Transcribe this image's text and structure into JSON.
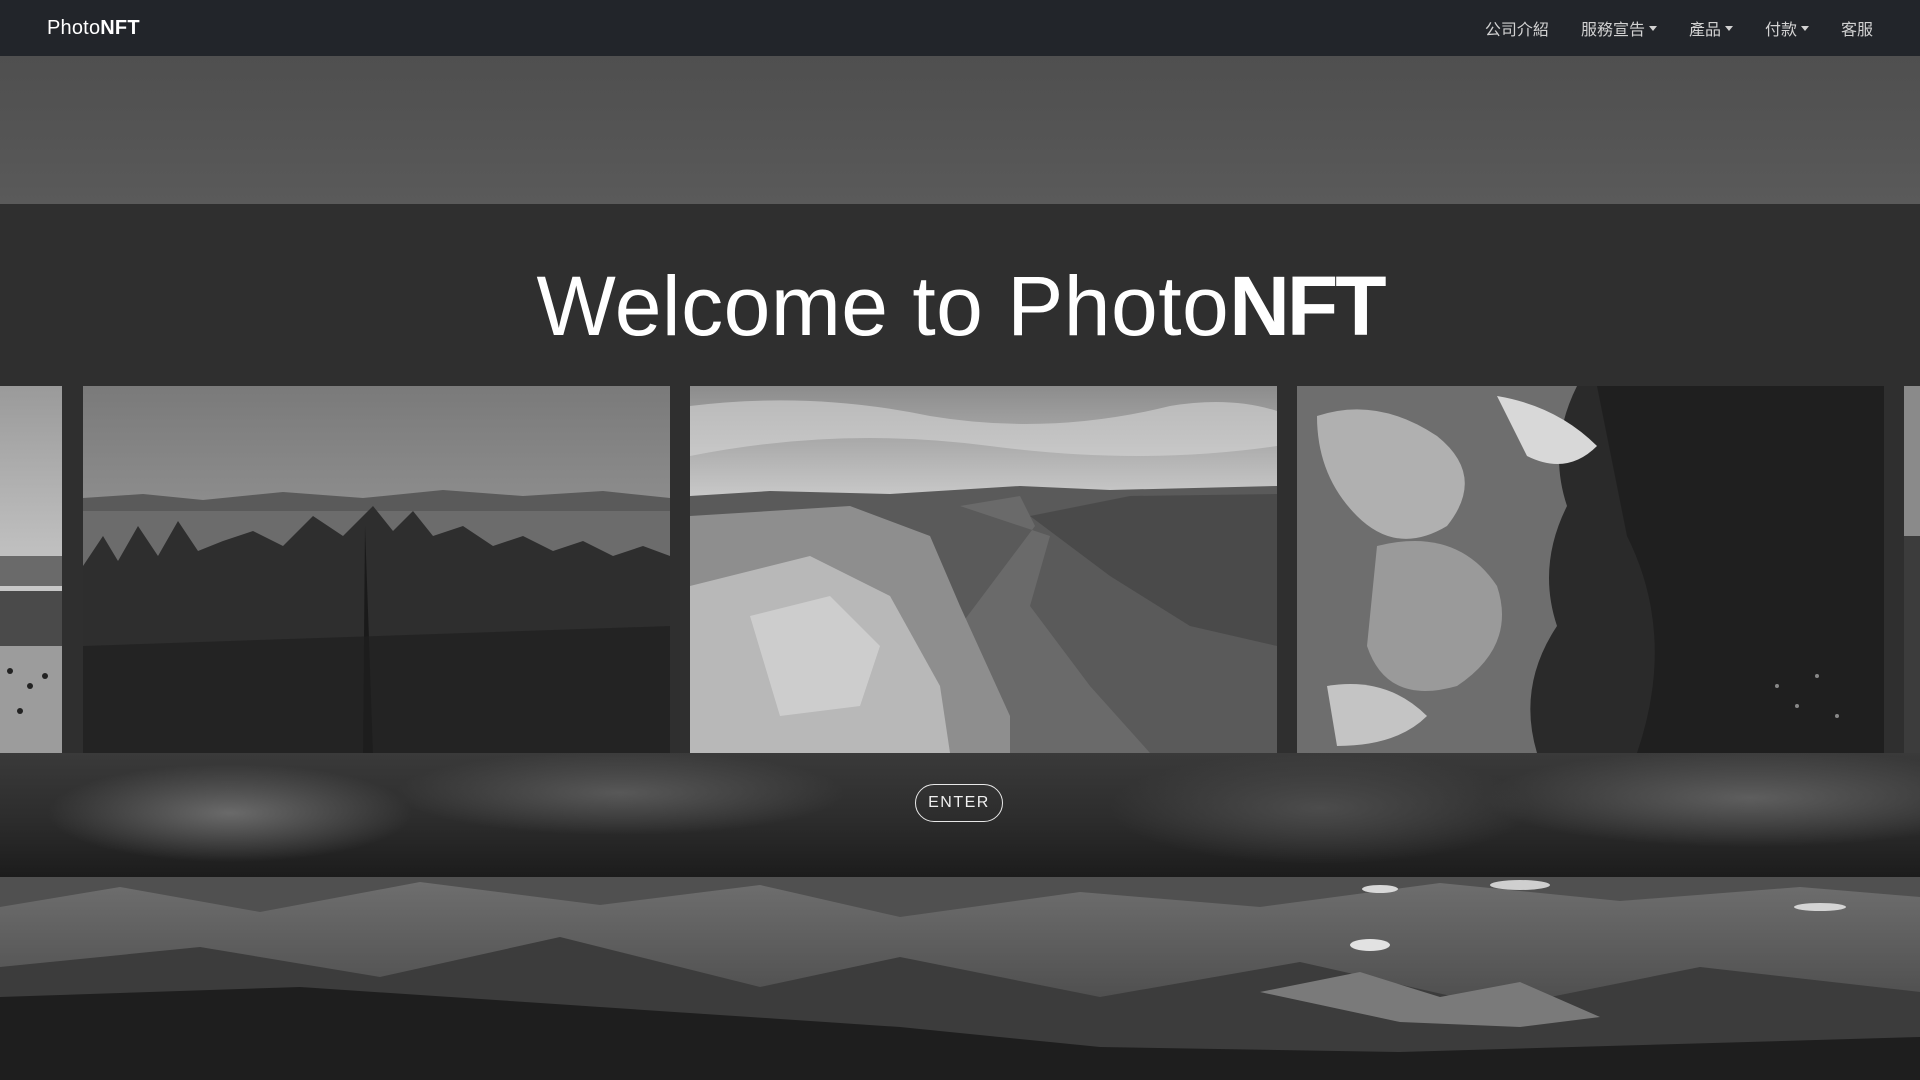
{
  "navbar": {
    "brand_regular": "Photo",
    "brand_bold": "NFT",
    "items": [
      {
        "label": "公司介紹",
        "dropdown": false
      },
      {
        "label": "服務宣告",
        "dropdown": true
      },
      {
        "label": "產品",
        "dropdown": true
      },
      {
        "label": "付款",
        "dropdown": true
      },
      {
        "label": "客服",
        "dropdown": false
      }
    ]
  },
  "hero": {
    "title_regular": "Welcome to Photo",
    "title_bold": "NFT",
    "enter_label": "ENTER"
  },
  "carousel": {
    "slides": [
      "beach-photo",
      "forest-lake-photo",
      "fjord-photo",
      "aerial-terrain-photo",
      "cliff-photo"
    ]
  },
  "colors": {
    "navbar_bg": "#22252a",
    "hero_bg": "#2f2f2f",
    "text": "#ffffff"
  }
}
